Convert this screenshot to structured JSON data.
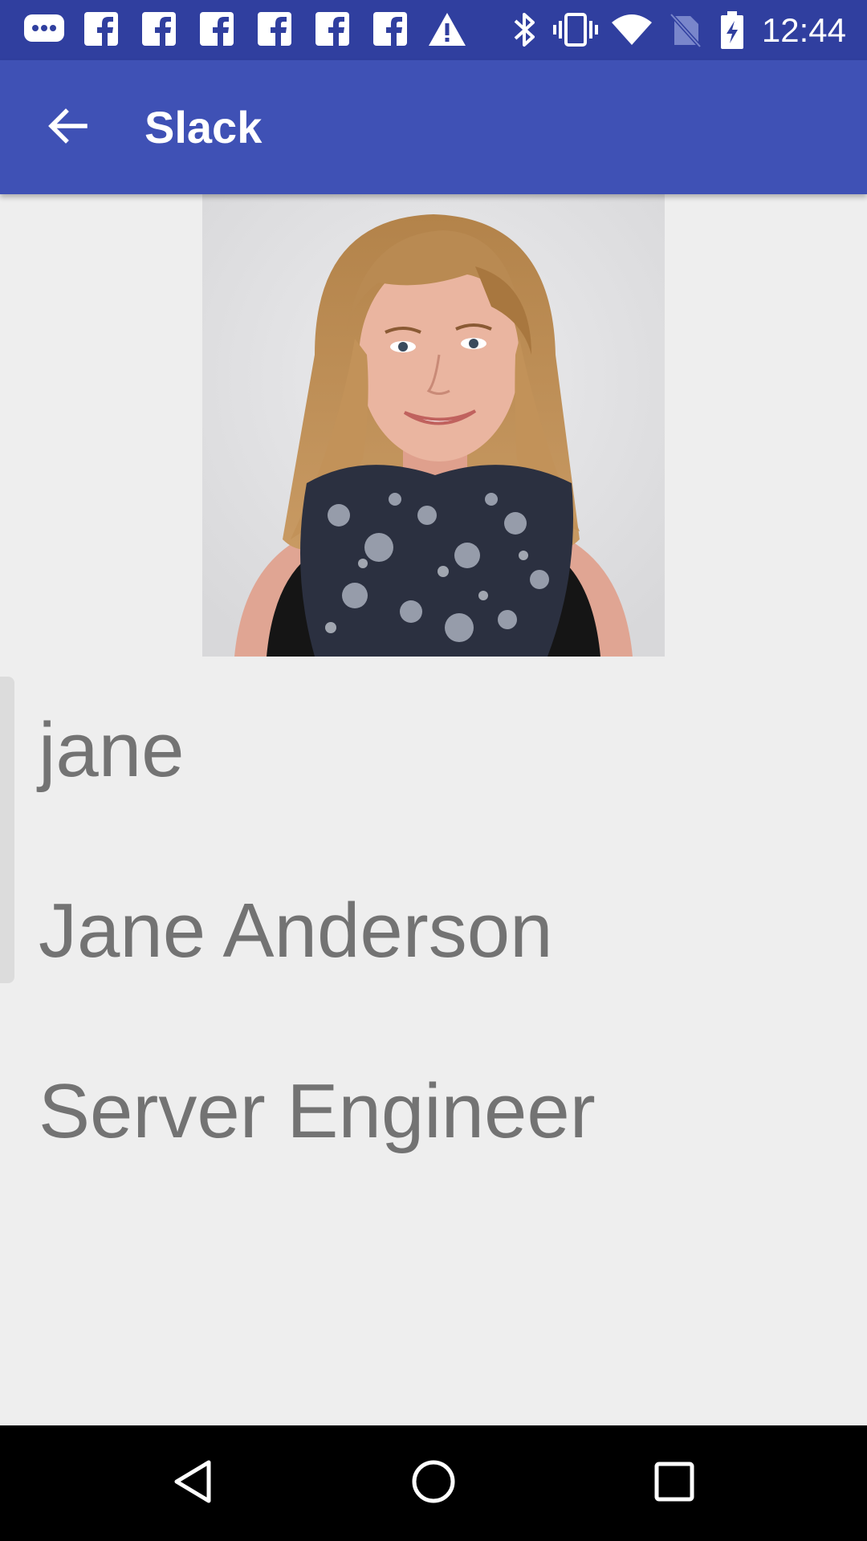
{
  "status_bar": {
    "time": "12:44",
    "notification_icons": [
      "messenger-icon",
      "facebook-icon",
      "facebook-icon",
      "facebook-icon",
      "facebook-icon",
      "facebook-icon",
      "facebook-icon",
      "warning-icon"
    ],
    "system_icons": [
      "bluetooth-icon",
      "vibrate-icon",
      "wifi-icon",
      "no-sim-icon",
      "battery-charging-icon"
    ]
  },
  "app_bar": {
    "title": "Slack",
    "back_icon": "arrow-back-icon"
  },
  "profile": {
    "photo": "profile-photo",
    "username": "jane",
    "full_name": "Jane Anderson",
    "job_title": "Server Engineer"
  },
  "nav_bar": {
    "buttons": [
      "back-triangle-icon",
      "home-circle-icon",
      "recents-square-icon"
    ]
  },
  "colors": {
    "status_bar": "#303f9f",
    "app_bar": "#3f51b5",
    "background": "#eeeeee",
    "text": "#737373",
    "nav_bar": "#000000"
  }
}
